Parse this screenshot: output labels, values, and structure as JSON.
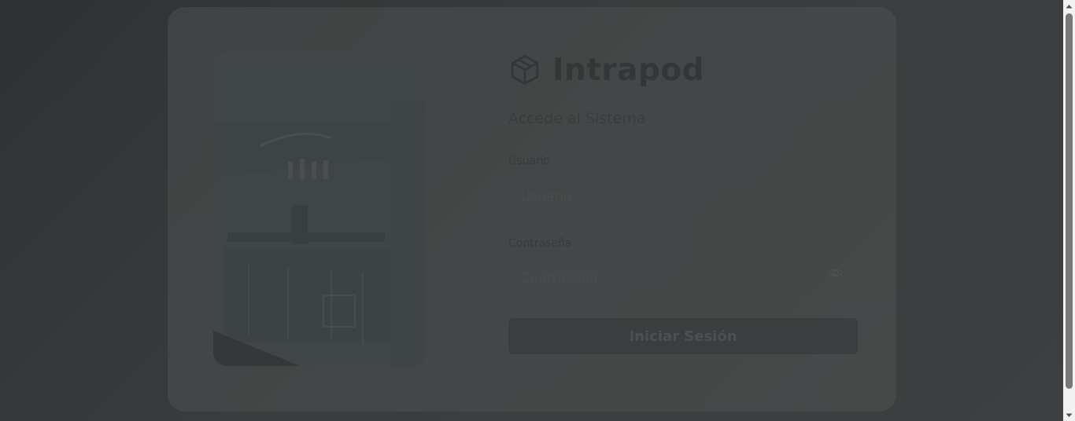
{
  "brand": {
    "name": "Intrapod",
    "icon": "package-box-icon"
  },
  "login": {
    "subtitle": "Accede al Sistema",
    "username": {
      "label": "Usuario",
      "placeholder": "Usuario",
      "value": ""
    },
    "password": {
      "label": "Contraseña",
      "placeholder": "Contraseña",
      "value": "",
      "toggle_icon": "eye-icon"
    },
    "submit_label": "Iniciar Sesión"
  },
  "illustration": {
    "icon": "office-interior-photo"
  },
  "colors": {
    "background": "#323436",
    "card": "#444647",
    "brand_text": "#343637",
    "button": "#3b3d3e"
  }
}
